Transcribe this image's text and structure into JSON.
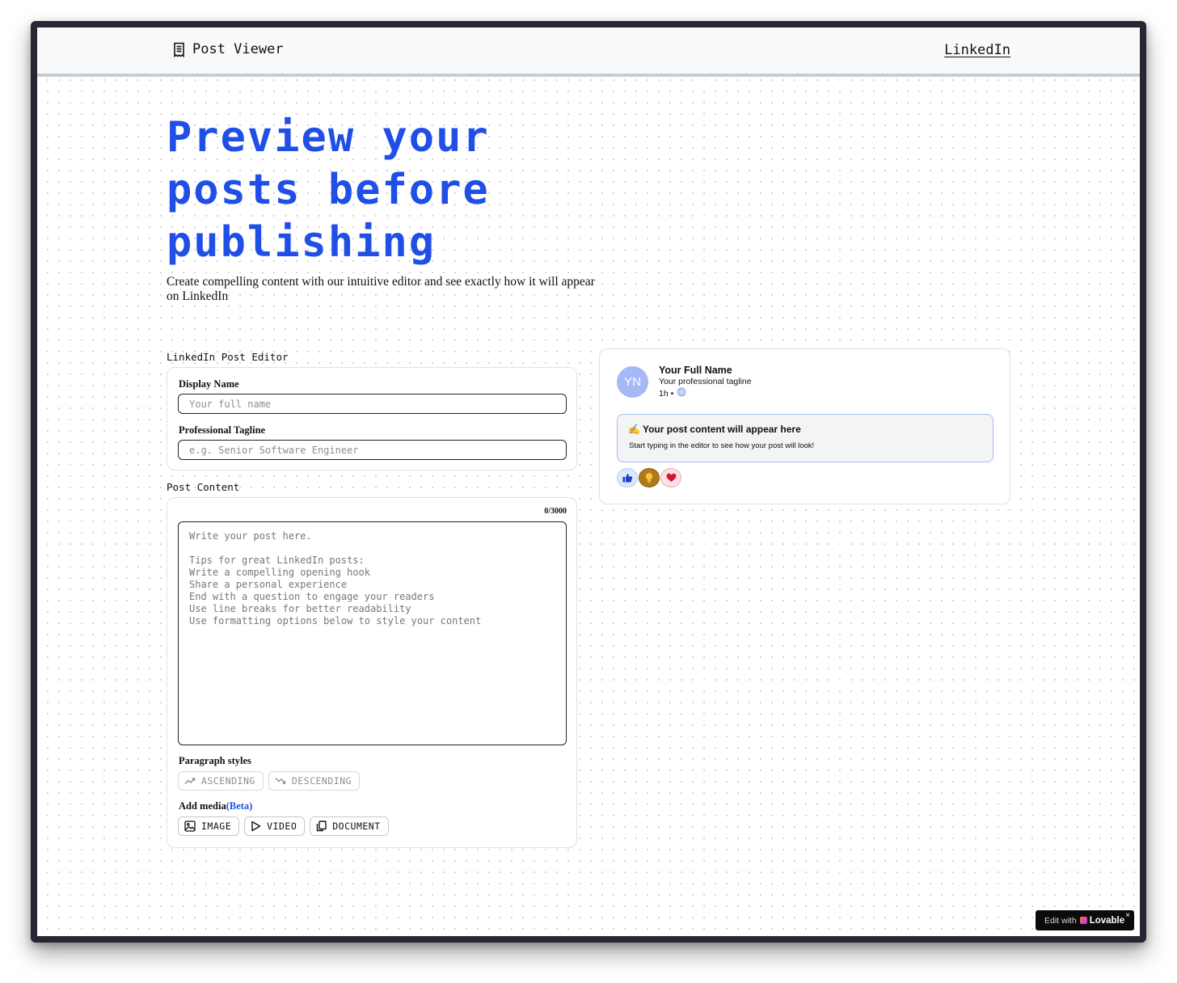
{
  "header": {
    "brand_icon": "receipt-icon",
    "brand_title": "Post Viewer",
    "nav_link": "LinkedIn"
  },
  "hero": {
    "title": "Preview your posts before publishing",
    "subtitle": "Create compelling content with our intuitive editor and see exactly how it will appear on LinkedIn"
  },
  "editor": {
    "section_title": "LinkedIn Post Editor",
    "display_name": {
      "label": "Display Name",
      "value": "",
      "placeholder": "Your full name"
    },
    "tagline": {
      "label": "Professional Tagline",
      "value": "",
      "placeholder": "e.g. Senior Software Engineer"
    },
    "content_section_title": "Post Content",
    "counter": "0/3000",
    "content": {
      "value": "",
      "placeholder": "Write your post here.\n\nTips for great LinkedIn posts:\nWrite a compelling opening hook\nShare a personal experience\nEnd with a question to engage your readers\nUse line breaks for better readability\nUse formatting options below to style your content"
    },
    "paragraph_styles": {
      "label": "Paragraph styles",
      "buttons": [
        {
          "label": "ASCENDING",
          "icon": "trend-up-icon"
        },
        {
          "label": "DESCENDING",
          "icon": "trend-down-icon"
        }
      ]
    },
    "media": {
      "label": "Add media",
      "beta": "(Beta)",
      "buttons": [
        {
          "label": "IMAGE",
          "icon": "image-icon"
        },
        {
          "label": "VIDEO",
          "icon": "play-icon"
        },
        {
          "label": "DOCUMENT",
          "icon": "copy-icon"
        }
      ]
    }
  },
  "preview": {
    "avatar_initials": "YN",
    "name": "Your Full Name",
    "tagline": "Your professional tagline",
    "time": "1h •",
    "content_emoji": "✍️",
    "content_title": "Your post content will appear here",
    "content_subtitle": "Start typing in the editor to see how your post will look!",
    "reactions": [
      "like-icon",
      "insightful-icon",
      "love-icon"
    ]
  },
  "badge": {
    "prefix": "Edit with",
    "brand": "Lovable",
    "close": "×"
  },
  "colors": {
    "accent": "#1f4fe6",
    "avatar": "#a7b8f7",
    "preview_border": "#a9bdf3"
  }
}
